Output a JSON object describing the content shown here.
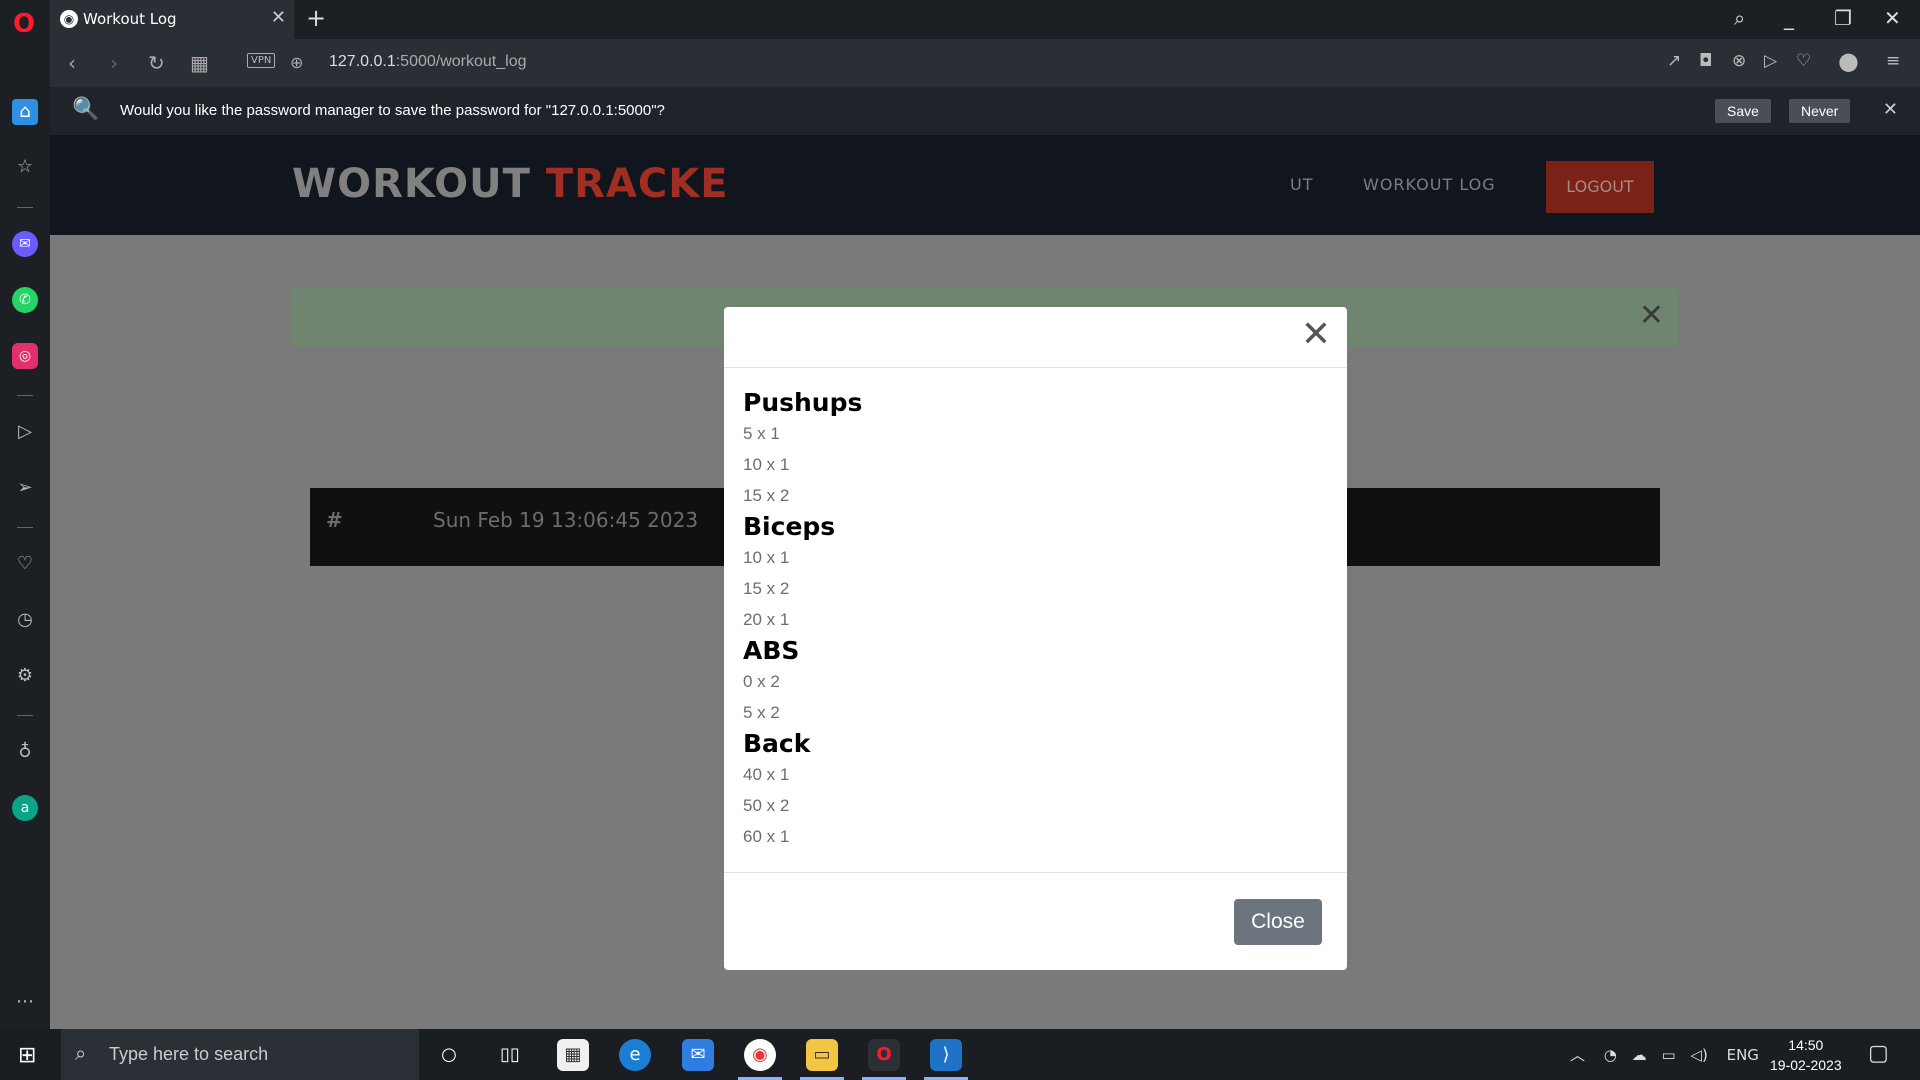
{
  "browser": {
    "tab_title": "Workout Log",
    "url_host": "127.0.0.1",
    "url_path": ":5000/workout_log",
    "vpn_label": "VPN"
  },
  "password_bar": {
    "message": "Would you like the password manager to save the password for \"127.0.0.1:5000\"?",
    "save_label": "Save",
    "never_label": "Never"
  },
  "site": {
    "brand_part1": "WORKOUT",
    "brand_part2": "TRACKE",
    "nav_partial": "UT",
    "nav_log": "WORKOUT LOG",
    "logout": "LOGOUT"
  },
  "table": {
    "hash": "#",
    "date": "Sun Feb 19 13:06:45 2023"
  },
  "modal": {
    "close_label": "Close",
    "exercises": [
      {
        "name": "Pushups",
        "sets": [
          "5 x 1",
          "10 x 1",
          "15 x 2"
        ]
      },
      {
        "name": "Biceps",
        "sets": [
          "10 x 1",
          "15 x 2",
          "20 x 1"
        ]
      },
      {
        "name": "ABS",
        "sets": [
          "0 x 2",
          "5 x 2"
        ]
      },
      {
        "name": "Back",
        "sets": [
          "40 x 1",
          "50 x 2",
          "60 x 1"
        ]
      }
    ]
  },
  "taskbar": {
    "search_placeholder": "Type here to search",
    "lang": "ENG",
    "time": "14:50",
    "date": "19-02-2023"
  },
  "colors": {
    "brand_accent": "#a12e22",
    "close_button": "#6c757d",
    "overlay": "#7a7a7a"
  }
}
